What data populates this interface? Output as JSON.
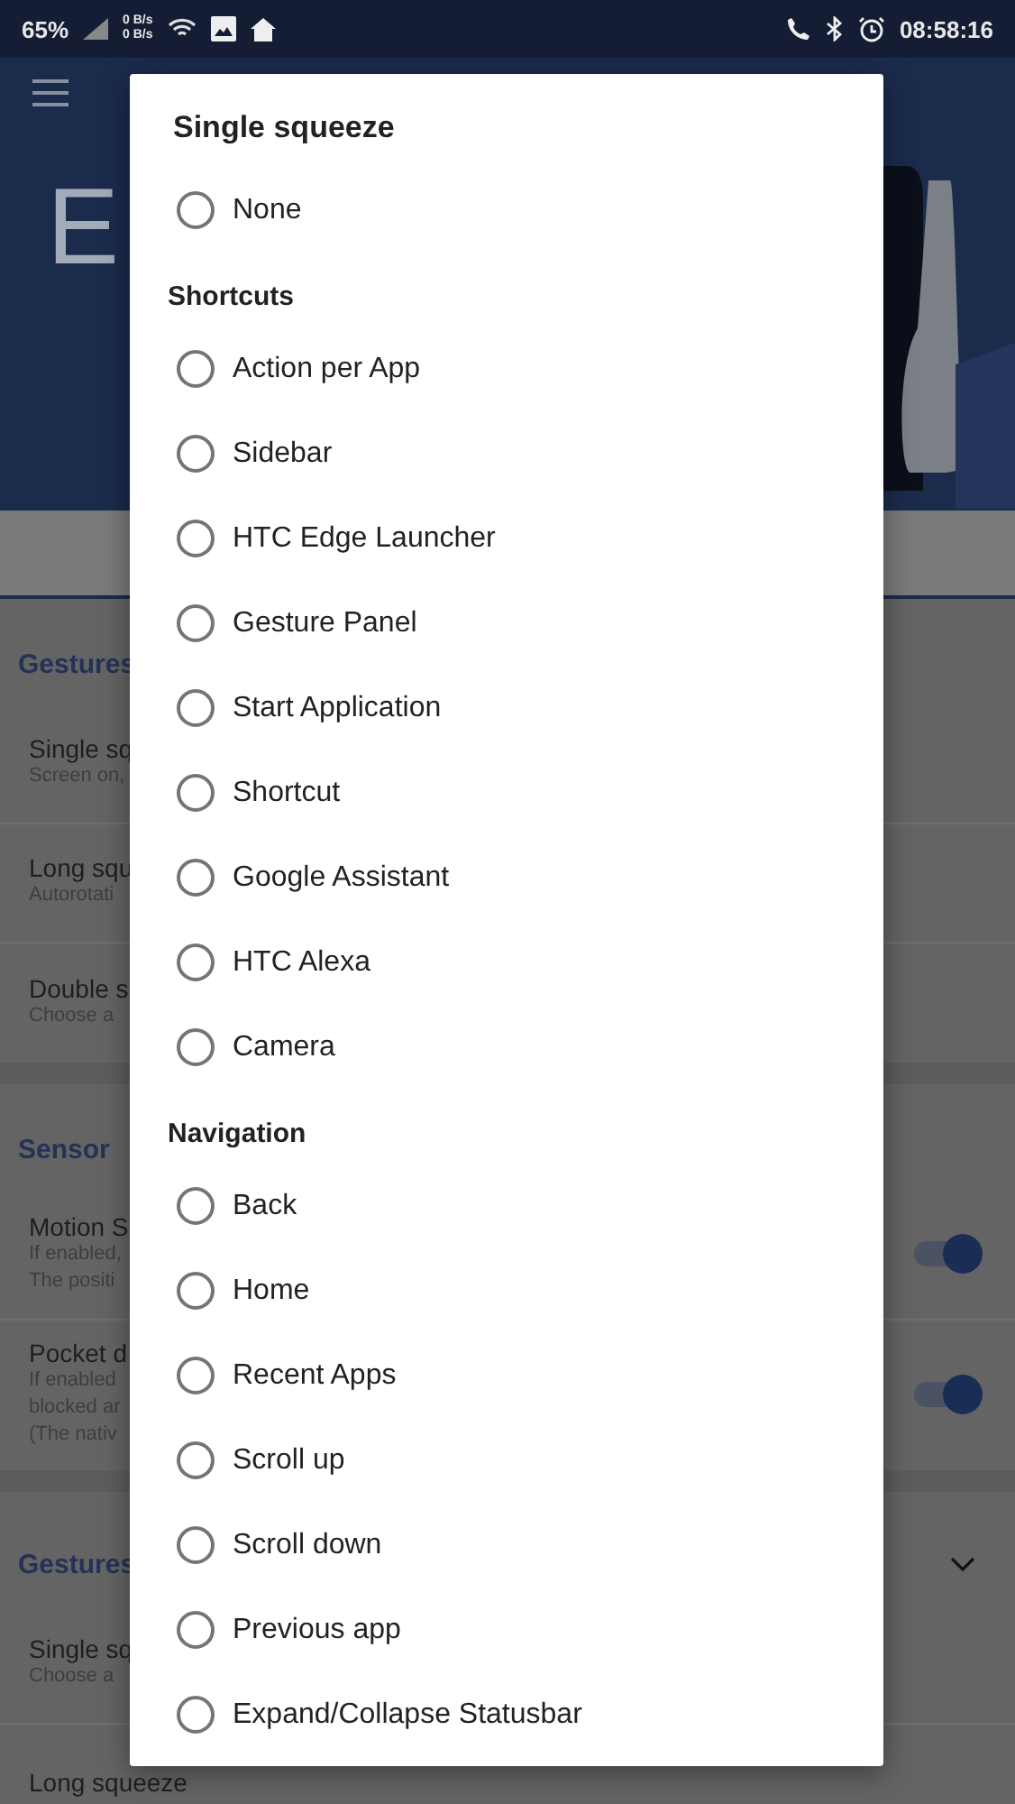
{
  "status_bar": {
    "battery": "65%",
    "net_up": "0 B/s",
    "net_down": "0 B/s",
    "time": "08:58:16"
  },
  "header": {
    "title": "E"
  },
  "sections": [
    {
      "heading": "Gestures",
      "items": [
        {
          "title": "Single sq",
          "lines": [
            "Screen on,"
          ]
        },
        {
          "title": "Long squ",
          "lines": [
            "Autorotati"
          ]
        },
        {
          "title": "Double s",
          "lines": [
            "Choose a"
          ]
        }
      ]
    },
    {
      "heading": "Sensor",
      "items": [
        {
          "title": "Motion S",
          "lines": [
            "If enabled,",
            "The positi"
          ],
          "on": true
        },
        {
          "title": "Pocket d",
          "lines": [
            "If enabled",
            "blocked ar",
            "(The nativ"
          ],
          "on": true
        }
      ]
    },
    {
      "heading": "Gestures",
      "expanded": false,
      "items": [
        {
          "title": "Single sq",
          "lines": [
            "Choose a"
          ]
        },
        {
          "title": "Long squeeze"
        }
      ]
    }
  ],
  "dialog": {
    "title": "Single squeeze",
    "groups": [
      {
        "options": [
          {
            "label": "None",
            "selected": false
          }
        ]
      },
      {
        "heading": "Shortcuts",
        "options": [
          {
            "label": "Action per App",
            "selected": false
          },
          {
            "label": "Sidebar",
            "selected": false
          },
          {
            "label": "HTC Edge Launcher",
            "selected": false
          },
          {
            "label": "Gesture Panel",
            "selected": false
          },
          {
            "label": "Start Application",
            "selected": false
          },
          {
            "label": "Shortcut",
            "selected": false
          },
          {
            "label": "Google Assistant",
            "selected": false
          },
          {
            "label": "HTC Alexa",
            "selected": false
          },
          {
            "label": "Camera",
            "selected": false
          }
        ]
      },
      {
        "heading": "Navigation",
        "options": [
          {
            "label": "Back",
            "selected": false
          },
          {
            "label": "Home",
            "selected": false
          },
          {
            "label": "Recent Apps",
            "selected": false
          },
          {
            "label": "Scroll up",
            "selected": false
          },
          {
            "label": "Scroll down",
            "selected": false
          },
          {
            "label": "Previous app",
            "selected": false
          },
          {
            "label": "Expand/Collapse Statusbar",
            "selected": false
          }
        ]
      }
    ]
  }
}
